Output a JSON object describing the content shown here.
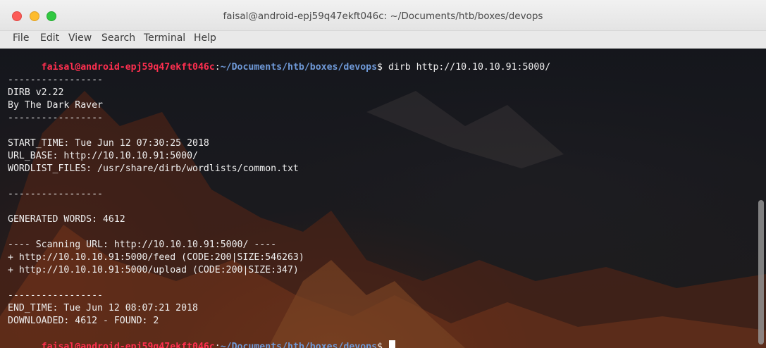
{
  "window": {
    "title": "faisal@android-epj59q47ekft046c: ~/Documents/htb/boxes/devops"
  },
  "menu": {
    "items": [
      "File",
      "Edit",
      "View",
      "Search",
      "Terminal",
      "Help"
    ]
  },
  "prompt": {
    "user_host": "faisal@android-epj59q47ekft046c",
    "colon": ":",
    "path": "~/Documents/htb/boxes/devops",
    "dollar": "$"
  },
  "command": " dirb http://10.10.10.91:5000/",
  "output": [
    "",
    "-----------------",
    "DIRB v2.22",
    "By The Dark Raver",
    "-----------------",
    "",
    "START_TIME: Tue Jun 12 07:30:25 2018",
    "URL_BASE: http://10.10.10.91:5000/",
    "WORDLIST_FILES: /usr/share/dirb/wordlists/common.txt",
    "",
    "-----------------",
    "",
    "GENERATED WORDS: 4612",
    "",
    "---- Scanning URL: http://10.10.10.91:5000/ ----",
    "+ http://10.10.10.91:5000/feed (CODE:200|SIZE:546263)",
    "+ http://10.10.10.91:5000/upload (CODE:200|SIZE:347)",
    "",
    "-----------------",
    "END_TIME: Tue Jun 12 08:07:21 2018",
    "DOWNLOADED: 4612 - FOUND: 2"
  ],
  "colors": {
    "prompt_user": "#ff2f4f",
    "prompt_path": "#6f9ad8",
    "text": "#efefef"
  }
}
